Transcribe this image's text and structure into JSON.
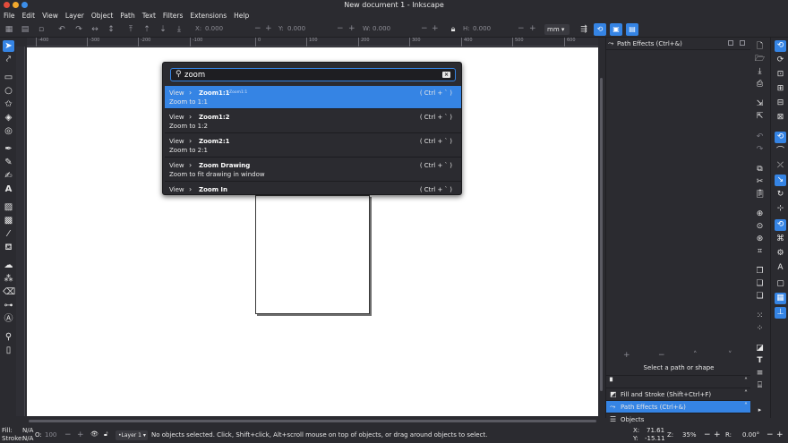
{
  "window": {
    "title": "New document 1 - Inkscape",
    "controls": [
      "#e34c3c",
      "#f0a92d",
      "#3c8ee8"
    ]
  },
  "menubar": [
    "File",
    "Edit",
    "View",
    "Layer",
    "Object",
    "Path",
    "Text",
    "Filters",
    "Extensions",
    "Help"
  ],
  "toolbar": {
    "x_label": "X:",
    "x_value": "0.000",
    "y_label": "Y:",
    "y_value": "0.000",
    "w_label": "W:",
    "w_value": "0.000",
    "h_label": "H:",
    "h_value": "0.000",
    "unit": "mm",
    "minus": "−",
    "plus": "+"
  },
  "ruler": {
    "ticks": [
      "-400",
      "-300",
      "-200",
      "-100",
      "0",
      "100",
      "200",
      "300",
      "400",
      "500",
      "600",
      "700"
    ]
  },
  "command_palette": {
    "query": "zoom",
    "commands": [
      {
        "category": "View",
        "name": "Zoom1:1",
        "id": "Zoom1:1",
        "shortcut": "( Ctrl + ` )",
        "description": "Zoom to 1:1",
        "selected": true
      },
      {
        "category": "View",
        "name": "Zoom1:2",
        "id": "",
        "shortcut": "( Ctrl + ` )",
        "description": "Zoom to 1:2",
        "selected": false
      },
      {
        "category": "View",
        "name": "Zoom2:1",
        "id": "",
        "shortcut": "( Ctrl + ` )",
        "description": "Zoom to 2:1",
        "selected": false
      },
      {
        "category": "View",
        "name": "Zoom Drawing",
        "id": "",
        "shortcut": "( Ctrl + ` )",
        "description": "Zoom to fit drawing in window",
        "selected": false
      },
      {
        "category": "View",
        "name": "Zoom In",
        "id": "",
        "shortcut": "( Ctrl + ` )",
        "description": "",
        "selected": false
      }
    ]
  },
  "dock": {
    "tab_label": "Path Effects (Ctrl+&)",
    "actions": [
      "+",
      "−",
      "˄",
      "˅"
    ],
    "message": "Select a path or shape",
    "rows": [
      {
        "label": "",
        "icon": "document-icon",
        "active": false
      },
      {
        "label": "Fill and Stroke (Shift+Ctrl+F)",
        "icon": "fill-stroke-icon",
        "active": false
      },
      {
        "label": "Path Effects (Ctrl+&)",
        "icon": "path-effects-icon",
        "active": true
      },
      {
        "label": "Objects",
        "icon": "objects-icon",
        "active": false
      }
    ]
  },
  "statusbar": {
    "fill_label": "Fill:",
    "fill_value": "N/A",
    "stroke_label": "Stroke:",
    "stroke_value": "N/A",
    "opacity_label": "O:",
    "opacity_value": "100",
    "layer": "•Layer 1",
    "message": "No objects selected. Click, Shift+click, Alt+scroll mouse on top of objects, or drag around objects to select.",
    "x_label": "X:",
    "x_value": "71.61",
    "y_label": "Y:",
    "y_value": "-15.11",
    "zoom_label": "Z:",
    "zoom_value": "35%",
    "rot_label": "R:",
    "rot_value": "0.00°"
  },
  "colors": {
    "accent": "#3584e4",
    "background": "#2b2b30",
    "canvas": "#ffffff"
  }
}
